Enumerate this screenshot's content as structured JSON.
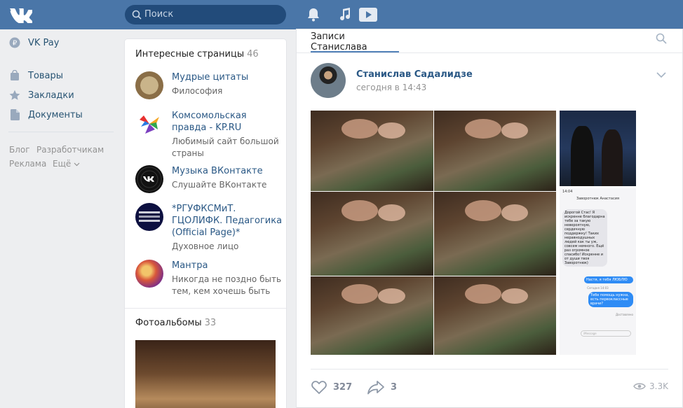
{
  "header": {
    "search_placeholder": "Поиск",
    "icons": [
      "vk-logo-icon",
      "search-icon",
      "bell-icon",
      "music-icon",
      "video-icon"
    ]
  },
  "left_nav": {
    "items": [
      {
        "label": "VK Pay",
        "icon": "ruble-icon"
      },
      {
        "label": "Товары",
        "icon": "bag-icon"
      },
      {
        "label": "Закладки",
        "icon": "star-icon"
      },
      {
        "label": "Документы",
        "icon": "document-icon"
      }
    ],
    "footer": {
      "blog": "Блог",
      "developers": "Разработчикам",
      "ads": "Реклама",
      "more": "Ещё"
    }
  },
  "interesting_pages": {
    "title": "Интересные страницы",
    "count": "46",
    "items": [
      {
        "name": "Мудрые цитаты",
        "desc": "Философия"
      },
      {
        "name": "Комсомольская правда - KP.RU",
        "desc": "Любимый сайт большой страны"
      },
      {
        "name": "Музыка ВКонтакте",
        "desc": "Слушайте ВКонтакте"
      },
      {
        "name": "*РГУФКСМиТ. ГЦОЛИФК. Педагогика (Official Page)*",
        "desc": "Духовное лицо"
      },
      {
        "name": "Мантра",
        "desc": "Никогда не поздно быть тем, кем хочешь быть"
      }
    ]
  },
  "photo_albums": {
    "title": "Фотоальбомы",
    "count": "33"
  },
  "wall": {
    "tab_label": "Записи Станислава",
    "post": {
      "author": "Станислав Садалидзе",
      "time": "сегодня в 14:43",
      "likes": "327",
      "shares": "3",
      "views": "3.3K"
    },
    "chat": {
      "time": "14:04",
      "contact": "Заворотнюк Анастасия",
      "msg_in": "Дорогой Стас! Я искренне благодарна тебе за такую невероятную, сердечную поддержку! Таких неравнодушных людей как ты уж, совсем немного. Ещё раз огромное спасибо! Искренне и от души твоя Заворотнюк)",
      "msg_out": "Настя, я тебя ЛЮБЛЮ",
      "timestamp": "Сегодня 14:03",
      "msg_out2": "Тебе помощь нужна, есть первоклассные врачи?",
      "delivered": "Доставлено",
      "input_placeholder": "iMessage"
    }
  },
  "colors": {
    "header": "#4a76a8",
    "link": "#2a5885",
    "accent": "#5181b8",
    "background": "#edeef0"
  }
}
